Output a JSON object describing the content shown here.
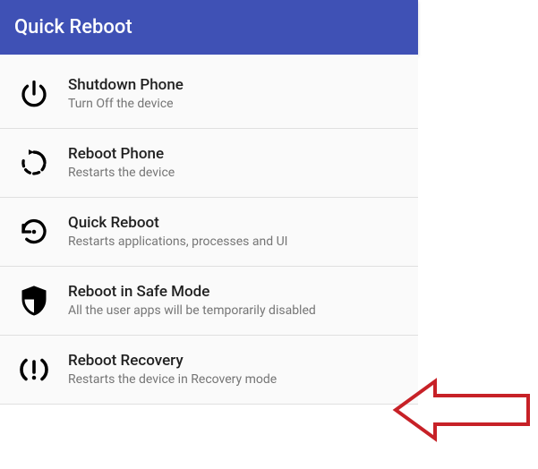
{
  "header": {
    "title": "Quick Reboot"
  },
  "items": [
    {
      "icon": "power-icon",
      "title": "Shutdown Phone",
      "subtitle": "Turn Off the device"
    },
    {
      "icon": "restart-icon",
      "title": "Reboot Phone",
      "subtitle": "Restarts the device"
    },
    {
      "icon": "history-icon",
      "title": "Quick Reboot",
      "subtitle": "Restarts applications, processes and UI"
    },
    {
      "icon": "shield-icon",
      "title": "Reboot in Safe Mode",
      "subtitle": "All the user apps will be temporarily disabled"
    },
    {
      "icon": "recovery-icon",
      "title": "Reboot Recovery",
      "subtitle": "Restarts the device in Recovery mode"
    }
  ],
  "annotation": {
    "arrow_color": "#c72127"
  }
}
